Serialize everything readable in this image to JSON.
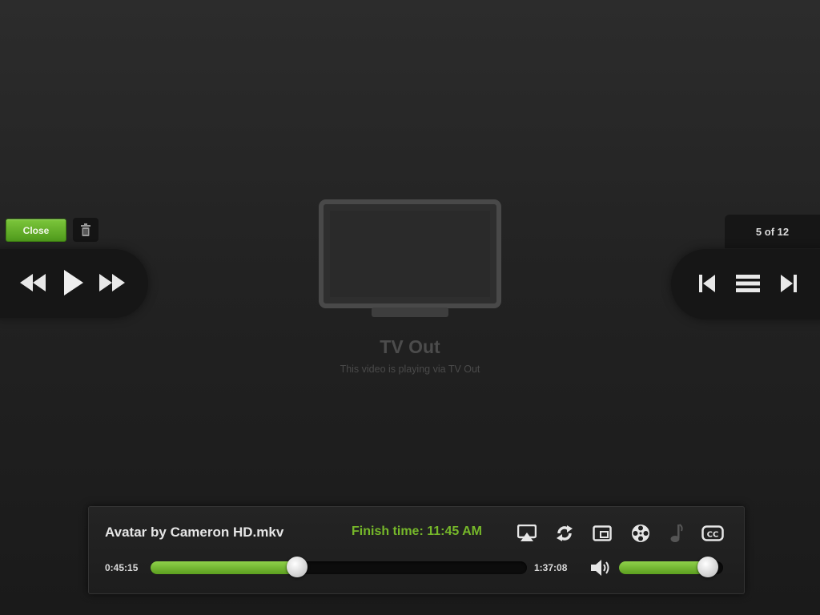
{
  "top_controls": {
    "close_label": "Close"
  },
  "counter": {
    "text": "5 of 12"
  },
  "tv_out": {
    "title": "TV Out",
    "subtitle": "This video is playing via TV Out"
  },
  "control_bar": {
    "file_name": "Avatar by Cameron HD.mkv",
    "finish_time": "Finish time: 11:45 AM",
    "elapsed": "0:45:15",
    "duration": "1:37:08",
    "progress_percent": 39,
    "volume_percent": 85,
    "icons": [
      "airplay-icon",
      "repeat-icon",
      "aspect-ratio-icon",
      "film-reel-icon",
      "music-note-icon",
      "closed-captions-icon"
    ]
  },
  "colors": {
    "accent_green": "#76b82a",
    "background": "#222222",
    "panel": "#161616"
  }
}
